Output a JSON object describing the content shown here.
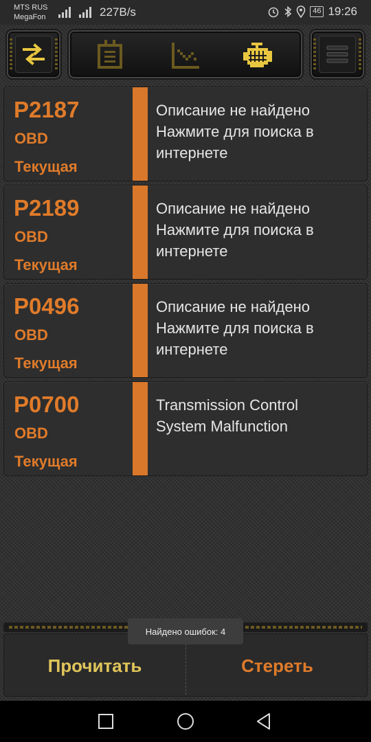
{
  "status_bar": {
    "carrier_1": "MTS RUS",
    "carrier_2": "MegaFon",
    "speed": "227B/s",
    "battery": "46",
    "time": "19:26"
  },
  "toolbar": {
    "left_icon": "swap-arrows-icon",
    "mid_icons": [
      "dashboard-icon",
      "graph-icon",
      "engine-icon"
    ],
    "active_icon": "engine-icon",
    "right_icon": "menu-icon"
  },
  "codes": [
    {
      "code": "P2187",
      "source": "OBD",
      "state": "Текущая",
      "description": [
        "Описание не найдено",
        "Нажмите для поиска в",
        "интернете"
      ]
    },
    {
      "code": "P2189",
      "source": "OBD",
      "state": "Текущая",
      "description": [
        "Описание не найдено",
        "Нажмите для поиска в",
        "интернете"
      ]
    },
    {
      "code": "P0496",
      "source": "OBD",
      "state": "Текущая",
      "description": [
        "Описание не найдено",
        "Нажмите для поиска в",
        "интернете"
      ]
    },
    {
      "code": "P0700",
      "source": "OBD",
      "state": "Текущая",
      "description": [
        "Transmission Control",
        "System Malfunction"
      ]
    }
  ],
  "actions": {
    "read_label": "Прочитать",
    "erase_label": "Стереть"
  },
  "toast": "Найдено ошибок: 4",
  "colors": {
    "accent_orange": "#e07b2a",
    "accent_yellow": "#e0c55a"
  }
}
